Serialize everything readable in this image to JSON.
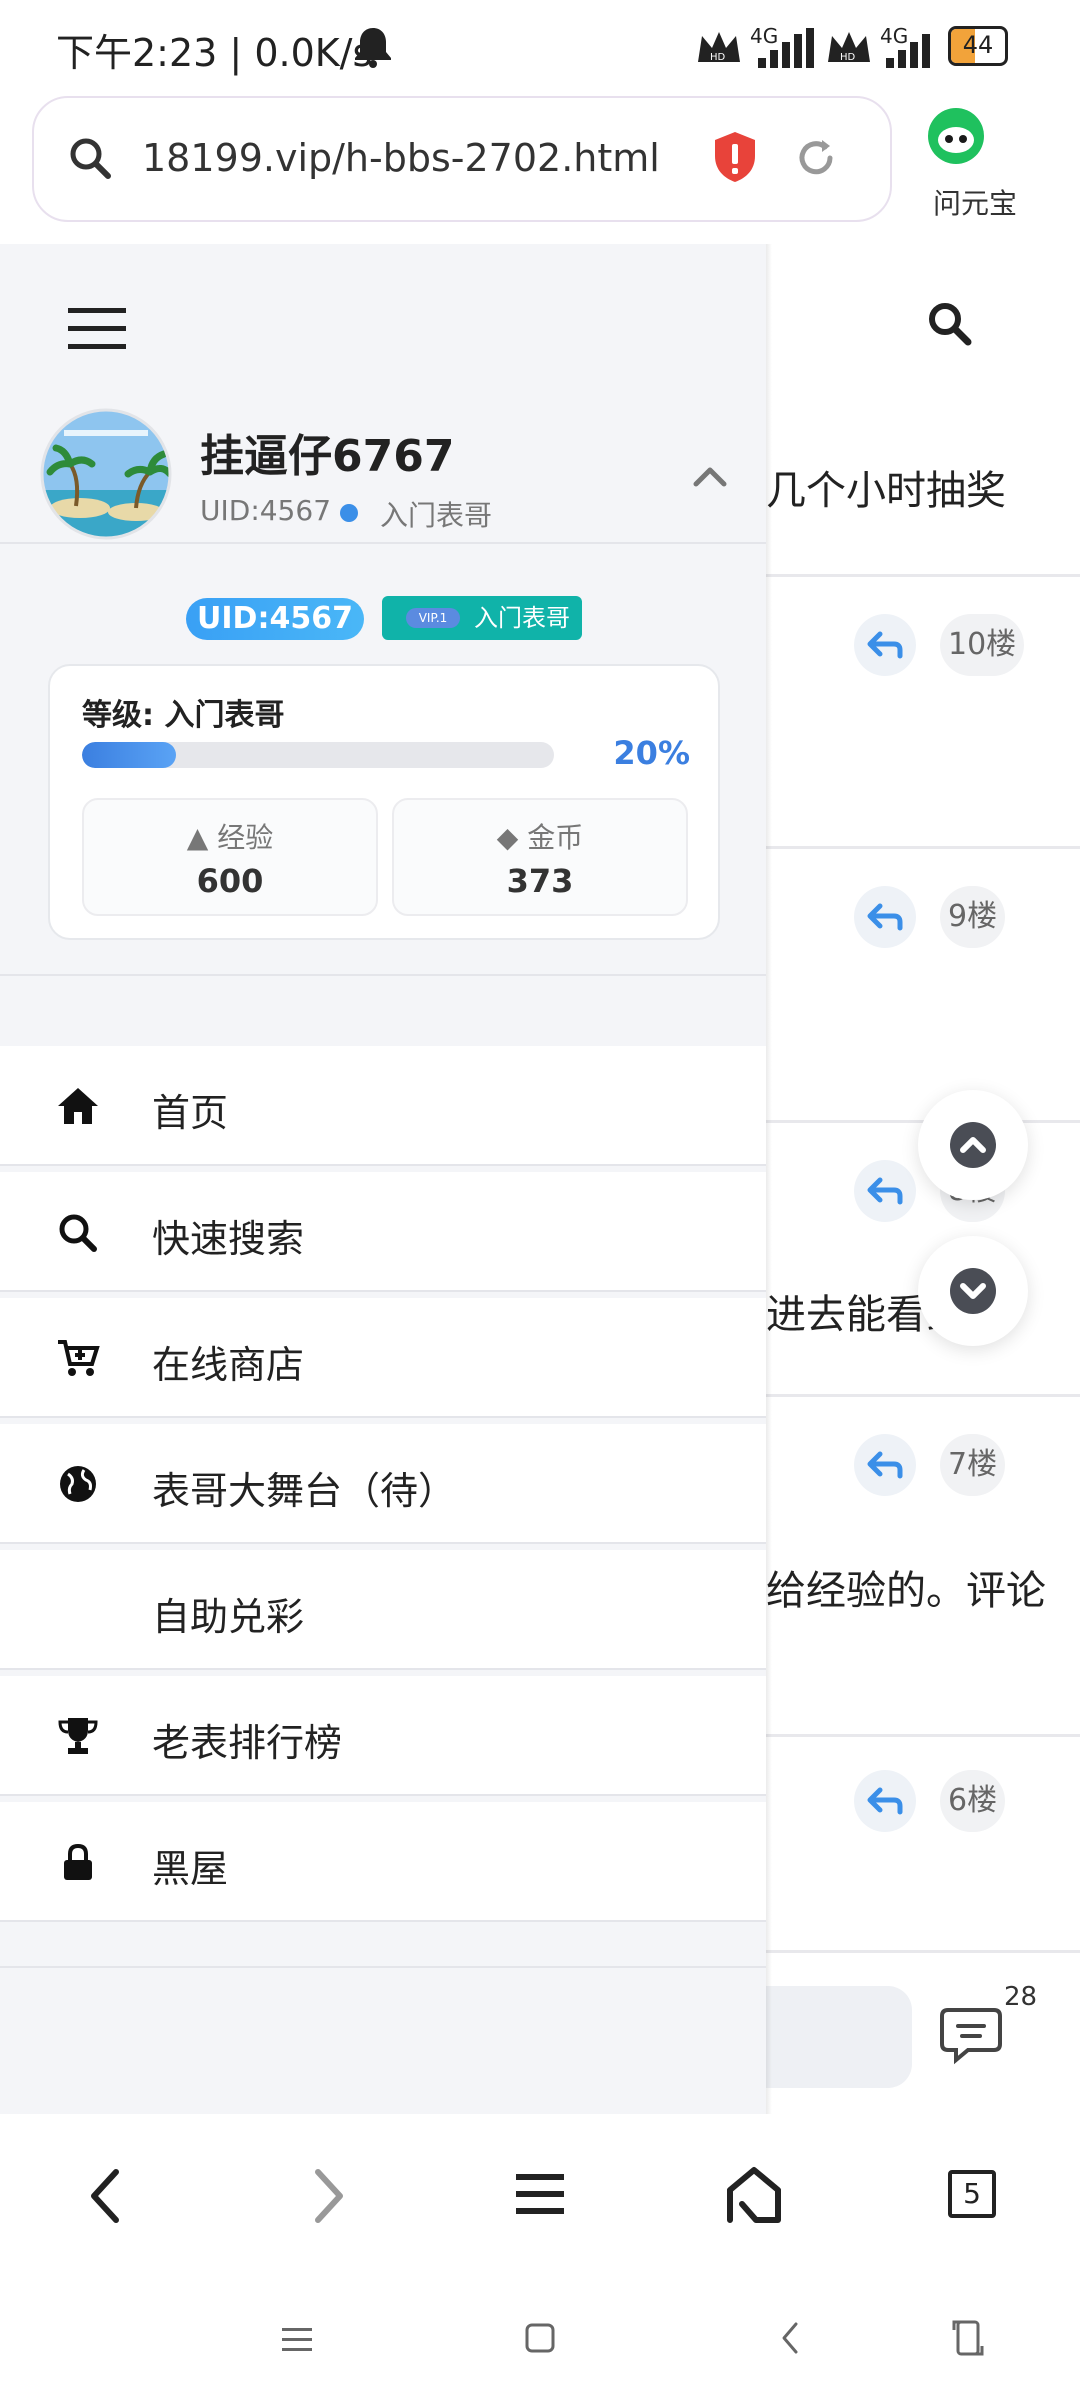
{
  "status_bar": {
    "time": "下午2:23",
    "speed": "0.0K/s",
    "signal_label": "4G",
    "hd_label": "HD",
    "battery_level": "44",
    "battery_fraction": 0.44,
    "battery_color": "#f2a33a"
  },
  "browser": {
    "url": "18199.vip/h-bbs-2702.html",
    "assistant_label": "问元宝"
  },
  "background_page": {
    "partial_texts": [
      "几个小时抽奖",
      "进去能看到",
      "给经验的。评论"
    ],
    "floors": [
      "10楼",
      "9楼",
      "8楼",
      "7楼",
      "6楼"
    ],
    "comment_count": "28"
  },
  "drawer": {
    "username": "挂逼仔6767",
    "uid_text": "UID:4567",
    "level_name": "入门表哥",
    "uid_pill": "UID:4567",
    "vip_mini": "VIP.1",
    "vip_label": "入门表哥",
    "level_title": "等级: 入门表哥",
    "progress_pct": "20%",
    "progress_fraction": 0.2,
    "exp_label": "经验",
    "exp_value": "600",
    "coin_label": "金币",
    "coin_value": "373",
    "menu": [
      {
        "label": "首页",
        "icon": "home-icon"
      },
      {
        "label": "快速搜索",
        "icon": "search-icon"
      },
      {
        "label": "在线商店",
        "icon": "cart-icon"
      },
      {
        "label": "表哥大舞台（待）",
        "icon": "globe-icon"
      },
      {
        "label": "自助兑彩",
        "icon": ""
      },
      {
        "label": "老表排行榜",
        "icon": "trophy-icon"
      },
      {
        "label": "黑屋",
        "icon": "lock-icon"
      }
    ]
  },
  "bottom_nav": {
    "tab_count": "5"
  },
  "colors": {
    "accent_blue": "#3b7fe0",
    "vip_teal": "#10b3a9",
    "shield_red": "#e8433a"
  }
}
